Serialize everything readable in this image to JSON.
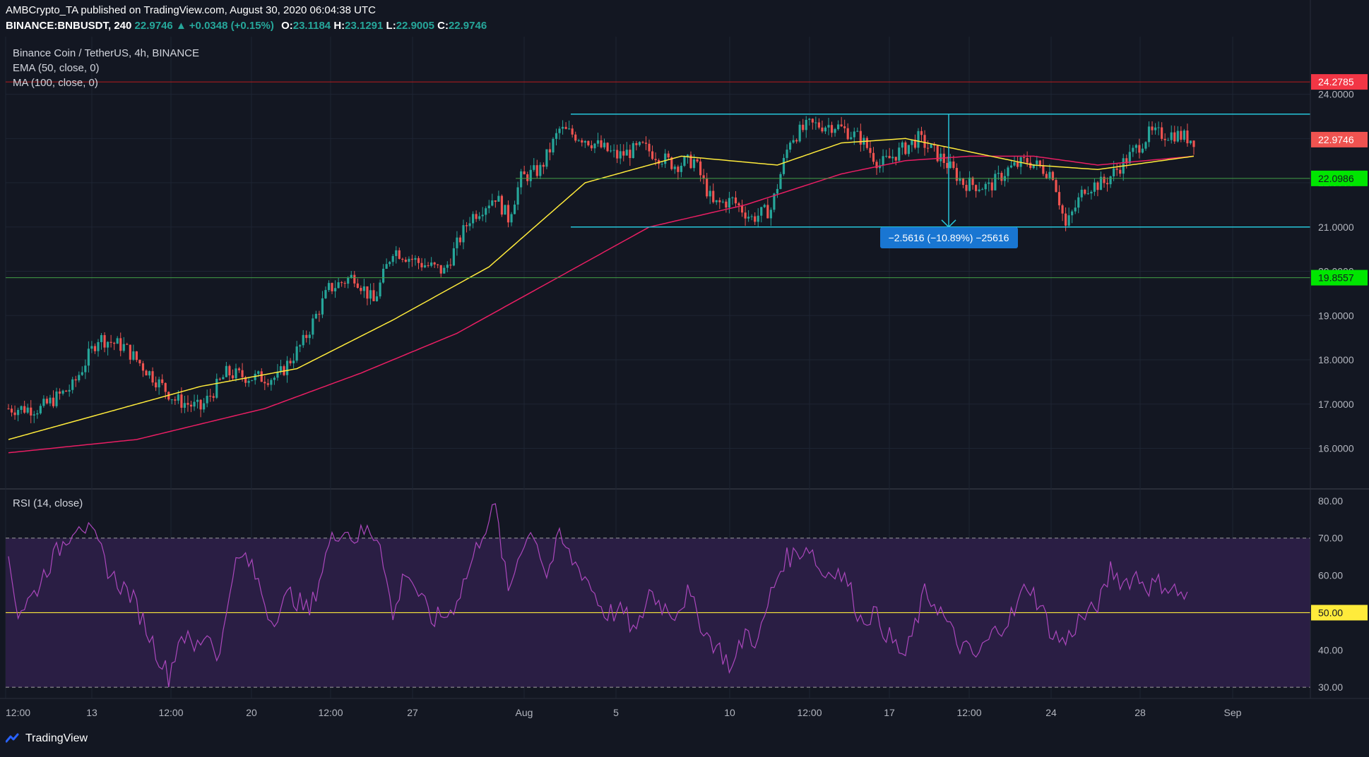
{
  "header": {
    "line1": "AMBCrypto_TA published on TradingView.com, August 30, 2020 06:04:38 UTC",
    "symbol": "BINANCE:BNBUSDT, 240",
    "price": "22.9746",
    "change_icon": "triangle-up-icon",
    "change": "+0.0348 (+0.15%)",
    "o_label": "O:",
    "o": "23.1184",
    "h_label": "H:",
    "h": "23.1291",
    "l_label": "L:",
    "l": "22.9005",
    "c_label": "C:",
    "c": "22.9746"
  },
  "legend": {
    "title": "Binance Coin / TetherUS, 4h, BINANCE",
    "ema": "EMA (50, close, 0)",
    "ma": "MA (100, close, 0)",
    "rsi": "RSI (14, close)"
  },
  "brand": {
    "name": "TradingView",
    "icon": "tradingview-logo-icon"
  },
  "colors": {
    "background": "#131722",
    "grid": "#1e2433",
    "up": "#26a69a",
    "down": "#ef5350",
    "ema": "#ffeb3b",
    "ma": "#e91e63",
    "rsi": "#ab47bc",
    "rsi_band": "#2a1e44",
    "channel": "#26c6da",
    "support": "#4caf50",
    "resistance": "#ff1744",
    "measure": "#1976d2",
    "axis_text": "#b2b5be"
  },
  "chart_data": [
    {
      "type": "candlestick",
      "title": "Binance Coin / TetherUS, 4h, BINANCE",
      "timeframe": "4h",
      "x_ticks": [
        "12:00",
        "13",
        "12:00",
        "20",
        "12:00",
        "27",
        "Aug",
        "5",
        "10",
        "12:00",
        "17",
        "12:00",
        "24",
        "28",
        "Sep"
      ],
      "y_ticks": [
        "16.0000",
        "17.0000",
        "18.0000",
        "19.0000",
        "20.0000",
        "21.0000",
        "22.0000",
        "23.0000",
        "24.0000"
      ],
      "ylim": [
        15.1,
        25.3
      ],
      "last_price": 22.9746,
      "anchors": [
        [
          0,
          16.9
        ],
        [
          10,
          16.9
        ],
        [
          20,
          17.4
        ],
        [
          28,
          18.5
        ],
        [
          36,
          18.3
        ],
        [
          44,
          17.7
        ],
        [
          52,
          17.1
        ],
        [
          60,
          16.9
        ],
        [
          68,
          17.7
        ],
        [
          76,
          17.6
        ],
        [
          84,
          17.6
        ],
        [
          92,
          18.4
        ],
        [
          100,
          19.6
        ],
        [
          108,
          19.9
        ],
        [
          114,
          19.3
        ],
        [
          120,
          20.5
        ],
        [
          128,
          20.2
        ],
        [
          136,
          20.0
        ],
        [
          144,
          21.2
        ],
        [
          152,
          21.7
        ],
        [
          156,
          21.2
        ],
        [
          160,
          22.1
        ],
        [
          166,
          22.3
        ],
        [
          172,
          23.2
        ],
        [
          180,
          23.0
        ],
        [
          190,
          22.6
        ],
        [
          198,
          22.8
        ],
        [
          208,
          22.4
        ],
        [
          214,
          22.5
        ],
        [
          220,
          21.5
        ],
        [
          226,
          21.6
        ],
        [
          232,
          21.2
        ],
        [
          238,
          21.4
        ],
        [
          244,
          23.0
        ],
        [
          250,
          23.3
        ],
        [
          258,
          23.3
        ],
        [
          266,
          23.0
        ],
        [
          272,
          22.4
        ],
        [
          278,
          22.7
        ],
        [
          284,
          23.0
        ],
        [
          292,
          22.5
        ],
        [
          298,
          22.0
        ],
        [
          306,
          21.9
        ],
        [
          312,
          22.3
        ],
        [
          318,
          22.5
        ],
        [
          326,
          22.2
        ],
        [
          330,
          21.0
        ],
        [
          336,
          21.9
        ],
        [
          342,
          22.0
        ],
        [
          350,
          22.6
        ],
        [
          356,
          23.1
        ],
        [
          364,
          23.1
        ],
        [
          370,
          22.97
        ]
      ],
      "ema_50": [
        [
          0,
          16.2
        ],
        [
          30,
          16.8
        ],
        [
          60,
          17.4
        ],
        [
          90,
          17.8
        ],
        [
          120,
          18.9
        ],
        [
          150,
          20.1
        ],
        [
          180,
          22.0
        ],
        [
          210,
          22.6
        ],
        [
          240,
          22.4
        ],
        [
          260,
          22.9
        ],
        [
          280,
          23.0
        ],
        [
          300,
          22.7
        ],
        [
          320,
          22.4
        ],
        [
          340,
          22.3
        ],
        [
          370,
          22.6
        ]
      ],
      "ma_100": [
        [
          0,
          15.9
        ],
        [
          40,
          16.2
        ],
        [
          80,
          16.9
        ],
        [
          110,
          17.7
        ],
        [
          140,
          18.6
        ],
        [
          170,
          19.8
        ],
        [
          200,
          21.0
        ],
        [
          230,
          21.5
        ],
        [
          260,
          22.2
        ],
        [
          280,
          22.5
        ],
        [
          300,
          22.6
        ],
        [
          320,
          22.6
        ],
        [
          340,
          22.4
        ],
        [
          370,
          22.6
        ]
      ],
      "horizontal_levels": [
        {
          "value": 24.2785,
          "label": "24.2785",
          "color": "#ff1744"
        },
        {
          "value": 22.0986,
          "label": "22.0986",
          "color": "#4caf50"
        },
        {
          "value": 19.8557,
          "label": "19.8557",
          "color": "#4caf50"
        }
      ],
      "channel": {
        "top": 23.55,
        "bottom": 21.0
      },
      "measure_label": "−2.5616 (−10.89%) −25616"
    },
    {
      "type": "line",
      "title": "RSI (14, close)",
      "y_ticks": [
        "30.00",
        "40.00",
        "50.00",
        "60.00",
        "70.00",
        "80.00"
      ],
      "ylim": [
        27,
        83
      ],
      "band": [
        30,
        70
      ],
      "midline": {
        "value": 50,
        "label": "50.00"
      },
      "anchors": [
        [
          0,
          65
        ],
        [
          3,
          50
        ],
        [
          8,
          55
        ],
        [
          12,
          62
        ],
        [
          18,
          70
        ],
        [
          22,
          75
        ],
        [
          28,
          68
        ],
        [
          32,
          60
        ],
        [
          38,
          55
        ],
        [
          42,
          48
        ],
        [
          46,
          40
        ],
        [
          50,
          33
        ],
        [
          54,
          45
        ],
        [
          58,
          40
        ],
        [
          62,
          45
        ],
        [
          66,
          38
        ],
        [
          70,
          62
        ],
        [
          74,
          65
        ],
        [
          78,
          58
        ],
        [
          82,
          48
        ],
        [
          88,
          55
        ],
        [
          94,
          50
        ],
        [
          100,
          68
        ],
        [
          104,
          73
        ],
        [
          108,
          70
        ],
        [
          112,
          72
        ],
        [
          116,
          70
        ],
        [
          120,
          48
        ],
        [
          124,
          62
        ],
        [
          128,
          55
        ],
        [
          132,
          48
        ],
        [
          138,
          50
        ],
        [
          144,
          62
        ],
        [
          148,
          72
        ],
        [
          152,
          78
        ],
        [
          156,
          55
        ],
        [
          160,
          68
        ],
        [
          164,
          72
        ],
        [
          168,
          60
        ],
        [
          172,
          70
        ],
        [
          176,
          64
        ],
        [
          180,
          60
        ],
        [
          186,
          50
        ],
        [
          192,
          50
        ],
        [
          196,
          44
        ],
        [
          200,
          56
        ],
        [
          204,
          52
        ],
        [
          208,
          50
        ],
        [
          212,
          55
        ],
        [
          218,
          44
        ],
        [
          222,
          40
        ],
        [
          226,
          35
        ],
        [
          230,
          45
        ],
        [
          234,
          42
        ],
        [
          238,
          55
        ],
        [
          242,
          64
        ],
        [
          246,
          66
        ],
        [
          250,
          68
        ],
        [
          254,
          60
        ],
        [
          258,
          62
        ],
        [
          262,
          58
        ],
        [
          266,
          48
        ],
        [
          270,
          50
        ],
        [
          276,
          42
        ],
        [
          280,
          38
        ],
        [
          286,
          55
        ],
        [
          290,
          52
        ],
        [
          296,
          42
        ],
        [
          302,
          38
        ],
        [
          308,
          45
        ],
        [
          314,
          50
        ],
        [
          318,
          58
        ],
        [
          322,
          52
        ],
        [
          326,
          44
        ],
        [
          330,
          42
        ],
        [
          334,
          48
        ],
        [
          338,
          50
        ],
        [
          342,
          55
        ],
        [
          344,
          62
        ],
        [
          348,
          58
        ],
        [
          352,
          60
        ],
        [
          356,
          57
        ],
        [
          360,
          58
        ],
        [
          364,
          56
        ],
        [
          368,
          54
        ]
      ]
    }
  ]
}
